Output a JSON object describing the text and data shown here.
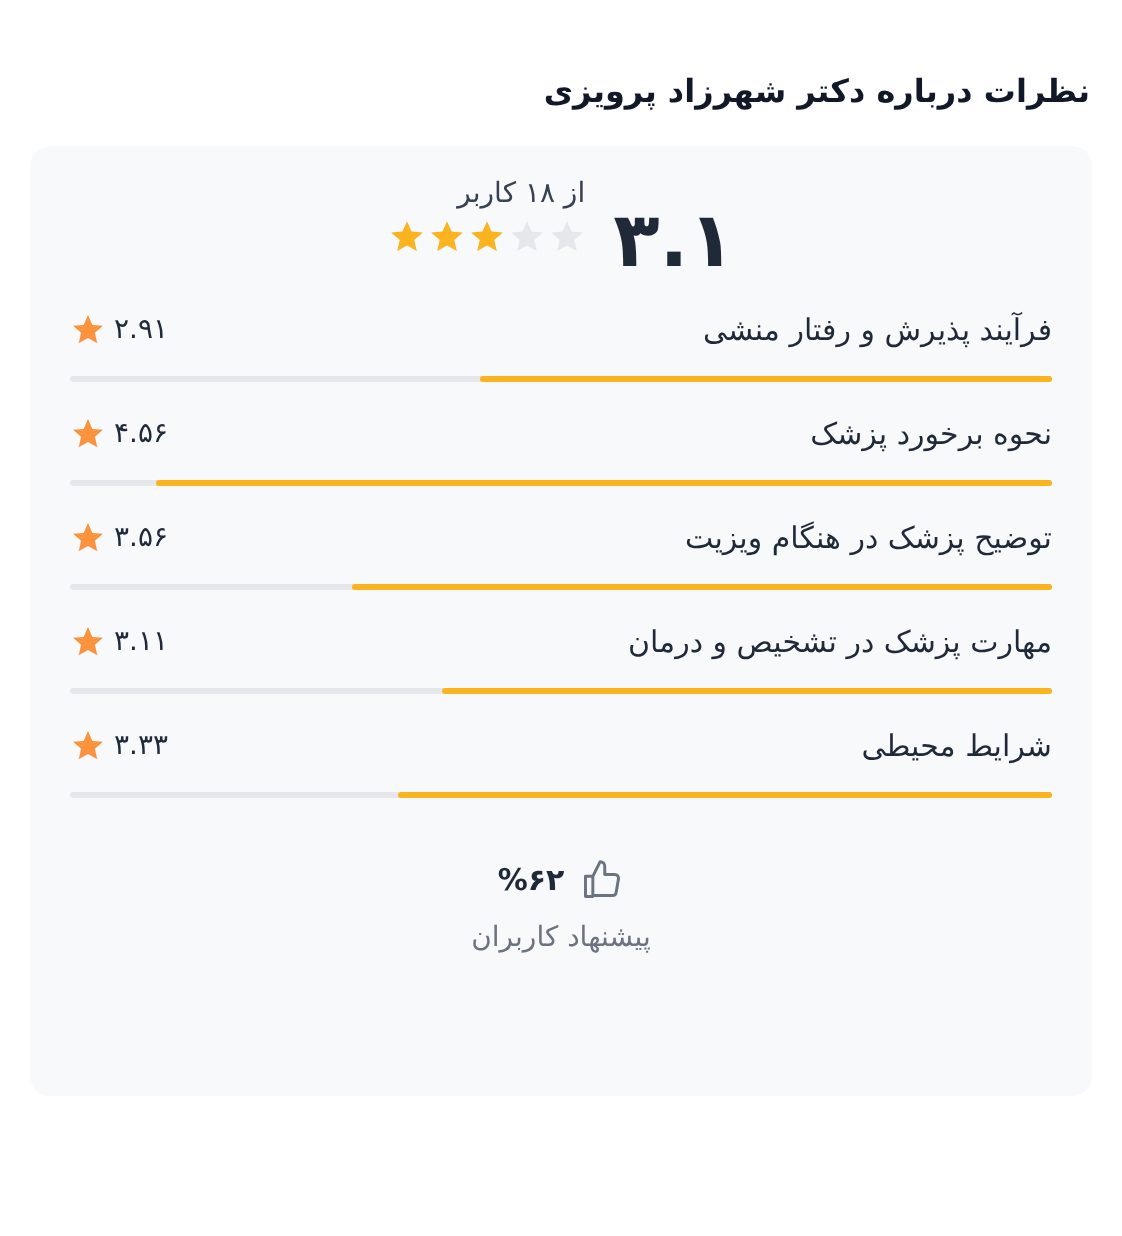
{
  "title": "نظرات درباره دکتر شهرزاد پرویزی",
  "summary": {
    "score": "۳.۱",
    "count": "از ۱۸ کاربر",
    "stars": 3
  },
  "criteria": [
    {
      "label": "فرآیند پذیرش و رفتار منشی",
      "score": "۲.۹۱",
      "level": 0.582
    },
    {
      "label": "نحوه برخورد پزشک",
      "score": "۴.۵۶",
      "level": 0.912
    },
    {
      "label": "توضیح پزشک در هنگام ویزیت",
      "score": "۳.۵۶",
      "level": 0.712
    },
    {
      "label": "مهارت پزشک در تشخیص و درمان",
      "score": "۳.۱۱",
      "level": 0.622
    },
    {
      "label": "شرایط محیطی",
      "score": "۳.۳۳",
      "level": 0.666
    }
  ],
  "recommend": {
    "percent": "%۶۲",
    "label": "پیشنهاد کاربران"
  }
}
